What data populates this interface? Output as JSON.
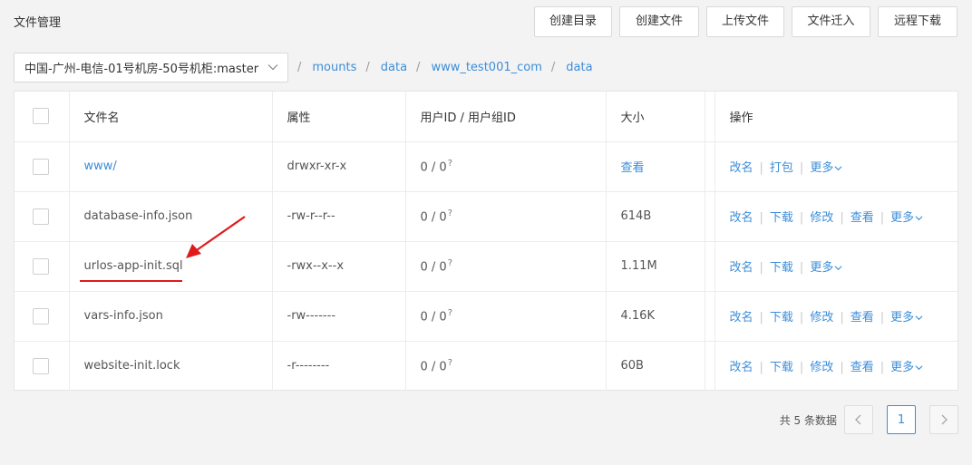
{
  "page": {
    "title": "文件管理"
  },
  "toolbar": {
    "buttons": [
      "创建目录",
      "创建文件",
      "上传文件",
      "文件迁入",
      "远程下载"
    ]
  },
  "server_select": {
    "value": "中国-广州-电信-01号机房-50号机柜:master"
  },
  "breadcrumb": {
    "items": [
      "mounts",
      "data",
      "www_test001_com",
      "data"
    ]
  },
  "table": {
    "headers": {
      "name": "文件名",
      "attr": "属性",
      "owner": "用户ID / 用户组ID",
      "size": "大小",
      "ops": "操作"
    },
    "rows": [
      {
        "name": "www/",
        "attr": "drwxr-xr-x",
        "owner": "0 / 0",
        "owner_sup": "?",
        "size": "查看",
        "ops": [
          "改名",
          "打包"
        ],
        "more": "更多"
      },
      {
        "name": "database-info.json",
        "attr": "-rw-r--r--",
        "owner": "0 / 0",
        "owner_sup": "?",
        "size": "614B",
        "ops": [
          "改名",
          "下载",
          "修改",
          "查看"
        ],
        "more": "更多"
      },
      {
        "name": "urlos-app-init.sql",
        "attr": "-rwx--x--x",
        "owner": "0 / 0",
        "owner_sup": "?",
        "size": "1.11M",
        "ops": [
          "改名",
          "下载"
        ],
        "more": "更多"
      },
      {
        "name": "vars-info.json",
        "attr": "-rw-------",
        "owner": "0 / 0",
        "owner_sup": "?",
        "size": "4.16K",
        "ops": [
          "改名",
          "下载",
          "修改",
          "查看"
        ],
        "more": "更多"
      },
      {
        "name": "website-init.lock",
        "attr": "-r--------",
        "owner": "0 / 0",
        "owner_sup": "?",
        "size": "60B",
        "ops": [
          "改名",
          "下载",
          "修改",
          "查看"
        ],
        "more": "更多"
      }
    ]
  },
  "pagination": {
    "total": "共 5 条数据",
    "current": "1"
  },
  "colors": {
    "link": "#3c8dd8",
    "annotation": "#e01b1b"
  },
  "icons": {
    "select": "chevron-down-icon",
    "prev": "chevron-left-icon",
    "next": "chevron-right-icon",
    "annotation": "red-arrow"
  }
}
